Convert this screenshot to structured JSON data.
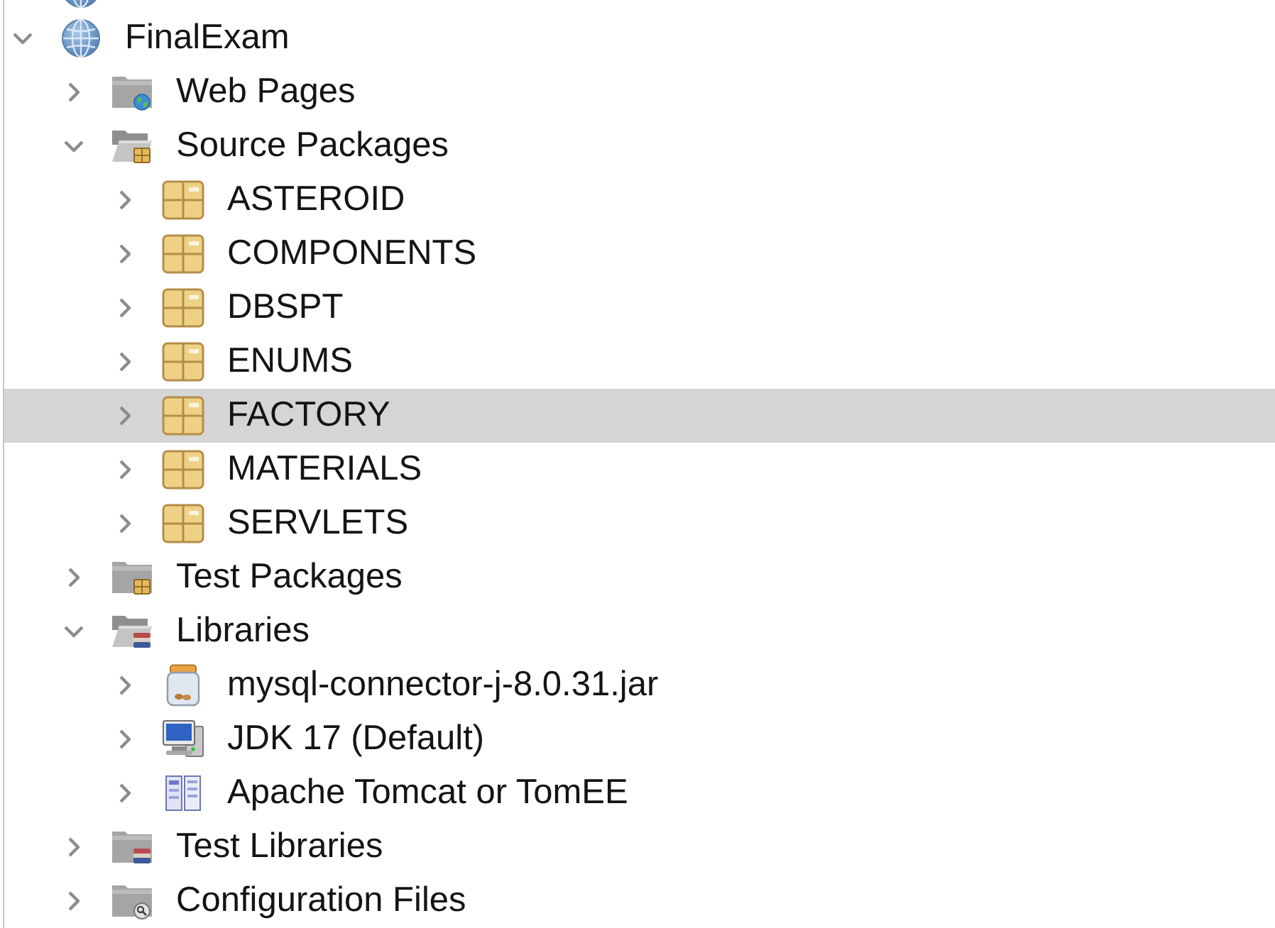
{
  "tree": [
    {
      "label": "FinalExam",
      "kind": "project",
      "expanded": true,
      "selected": false,
      "children": [
        {
          "label": "Web Pages",
          "kind": "web-folder",
          "expanded": false,
          "selected": false
        },
        {
          "label": "Source Packages",
          "kind": "source-folder",
          "expanded": true,
          "selected": false,
          "children": [
            {
              "label": "ASTEROID",
              "kind": "package",
              "expanded": false,
              "selected": false
            },
            {
              "label": "COMPONENTS",
              "kind": "package",
              "expanded": false,
              "selected": false
            },
            {
              "label": "DBSPT",
              "kind": "package",
              "expanded": false,
              "selected": false
            },
            {
              "label": "ENUMS",
              "kind": "package",
              "expanded": false,
              "selected": false
            },
            {
              "label": "FACTORY",
              "kind": "package",
              "expanded": false,
              "selected": true
            },
            {
              "label": "MATERIALS",
              "kind": "package",
              "expanded": false,
              "selected": false
            },
            {
              "label": "SERVLETS",
              "kind": "package",
              "expanded": false,
              "selected": false
            }
          ]
        },
        {
          "label": "Test Packages",
          "kind": "test-folder",
          "expanded": false,
          "selected": false
        },
        {
          "label": "Libraries",
          "kind": "library-folder",
          "expanded": true,
          "selected": false,
          "children": [
            {
              "label": "mysql-connector-j-8.0.31.jar",
              "kind": "jar",
              "expanded": false,
              "selected": false
            },
            {
              "label": "JDK 17 (Default)",
              "kind": "jdk",
              "expanded": false,
              "selected": false
            },
            {
              "label": "Apache Tomcat or TomEE",
              "kind": "server",
              "expanded": false,
              "selected": false
            }
          ]
        },
        {
          "label": "Test Libraries",
          "kind": "library-folder",
          "expanded": false,
          "selected": false
        },
        {
          "label": "Configuration Files",
          "kind": "config-folder",
          "expanded": false,
          "selected": false
        }
      ]
    }
  ]
}
